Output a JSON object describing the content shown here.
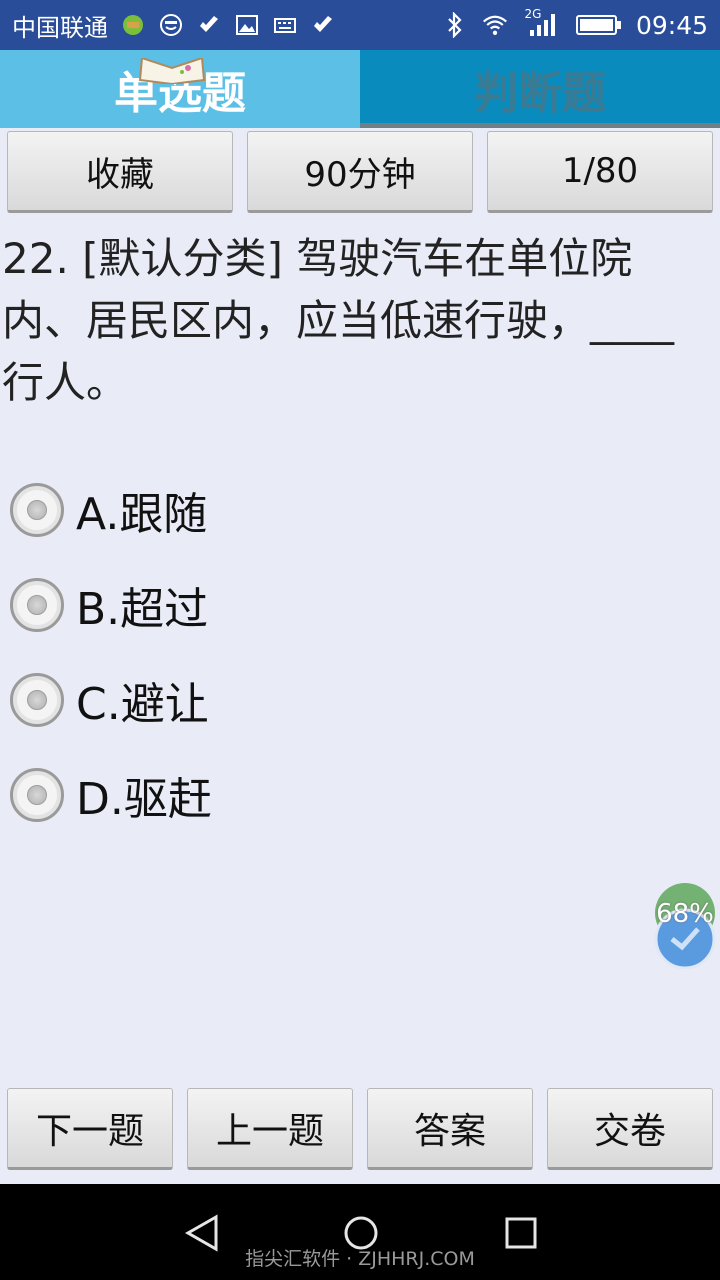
{
  "status_bar": {
    "carrier": "中国联通",
    "network_badge": "2G",
    "time": "09:45",
    "icons": [
      "map-icon",
      "smile-icon",
      "app-check-icon",
      "image-icon",
      "keyboard-icon",
      "app-check-icon",
      "bluetooth-icon",
      "wifi-icon",
      "signal-icon",
      "battery-icon"
    ]
  },
  "tabs": [
    {
      "label": "单选题",
      "active": true
    },
    {
      "label": "判断题",
      "active": false
    }
  ],
  "toolbar": {
    "favorite_label": "收藏",
    "timer_label": "90分钟",
    "progress_label": "1/80"
  },
  "question": {
    "text": "22. [默认分类] 驾驶汽车在单位院内、居民区内，应当低速行驶，____行人。"
  },
  "options": [
    {
      "label": "A.跟随"
    },
    {
      "label": "B.超过"
    },
    {
      "label": "C.避让"
    },
    {
      "label": "D.驱赶"
    }
  ],
  "floating_widget": {
    "percent_label": "68%"
  },
  "bottom_bar": {
    "next_label": "下一题",
    "prev_label": "上一题",
    "answer_label": "答案",
    "submit_label": "交卷"
  },
  "watermark": "指尖汇软件 · ZJHHRJ.COM",
  "colors": {
    "status_bar": "#2a4d9a",
    "tab_active": "#5bbfe6",
    "tab_inactive": "#0a8bbd",
    "background": "#e9ecf6"
  }
}
